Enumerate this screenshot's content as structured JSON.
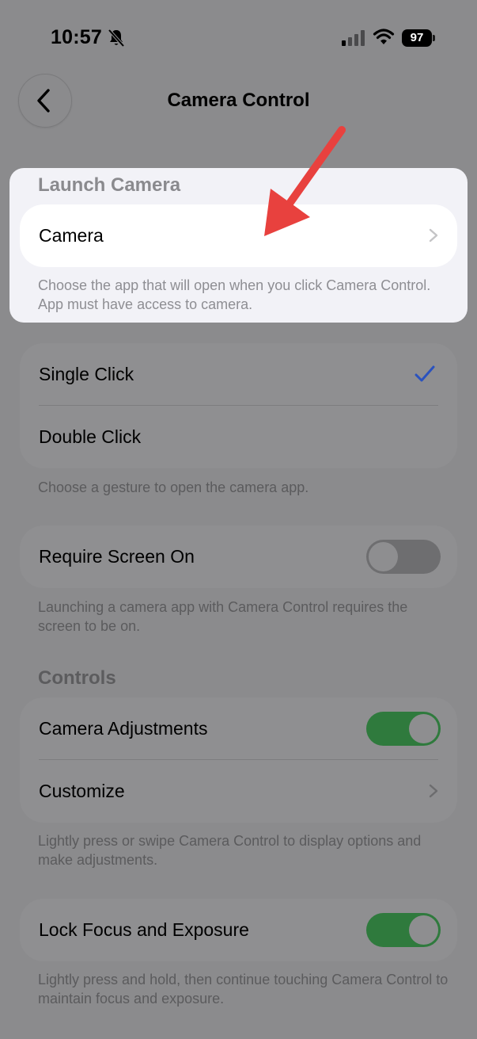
{
  "status_bar": {
    "time": "10:57",
    "battery": "97"
  },
  "nav": {
    "title": "Camera Control"
  },
  "launch_camera": {
    "header": "Launch Camera",
    "row_label": "Camera",
    "footer": "Choose the app that will open when you click Camera Control. App must have access to camera."
  },
  "gesture": {
    "options": [
      {
        "label": "Single Click",
        "selected": true
      },
      {
        "label": "Double Click",
        "selected": false
      }
    ],
    "footer": "Choose a gesture to open the camera app."
  },
  "require_screen": {
    "label": "Require Screen On",
    "enabled": false,
    "footer": "Launching a camera app with Camera Control requires the screen to be on."
  },
  "controls": {
    "header": "Controls",
    "rows": [
      {
        "label": "Camera Adjustments",
        "enabled": true
      },
      {
        "label": "Customize"
      }
    ],
    "footer": "Lightly press or swipe Camera Control to display options and make adjustments."
  },
  "lock_focus": {
    "label": "Lock Focus and Exposure",
    "enabled": true,
    "footer": "Lightly press and hold, then continue touching Camera Control to maintain focus and exposure."
  },
  "colors": {
    "accent_check": "#2a52be",
    "toggle_on": "#2f7a3d",
    "arrow": "#e8413e"
  }
}
